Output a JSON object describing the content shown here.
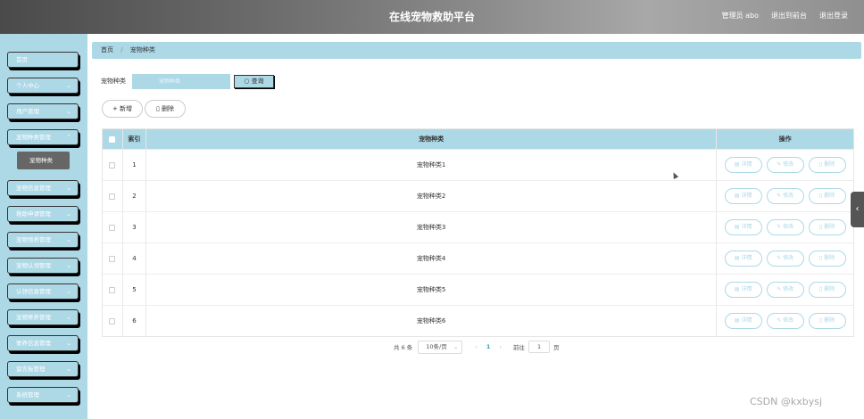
{
  "header": {
    "title": "在线宠物救助平台",
    "admin_label": "管理员 abo",
    "back_to_front": "退出到前台",
    "logout": "退出登录"
  },
  "sidebar": {
    "items": [
      {
        "label": "首页"
      },
      {
        "label": "个人中心"
      },
      {
        "label": "用户管理"
      },
      {
        "label": "宠物种类管理"
      },
      {
        "label": "宠物信息管理"
      },
      {
        "label": "救助申请管理"
      },
      {
        "label": "宠物领养管理"
      },
      {
        "label": "宠物认领管理"
      },
      {
        "label": "认领信息管理"
      },
      {
        "label": "宠物寄养管理"
      },
      {
        "label": "寄养信息管理"
      },
      {
        "label": "留言板管理"
      },
      {
        "label": "系统管理"
      }
    ],
    "submenu_item": "宠物种类"
  },
  "breadcrumb": {
    "home": "首页",
    "current": "宠物种类"
  },
  "search": {
    "label": "宠物种类",
    "placeholder": "宠物种类",
    "button": "查询"
  },
  "actions": {
    "add": "新增",
    "delete": "删除"
  },
  "table": {
    "headers": {
      "index": "索引",
      "name": "宠物种类",
      "ops": "操作"
    },
    "rows": [
      {
        "index": "1",
        "name": "宠物种类1"
      },
      {
        "index": "2",
        "name": "宠物种类2"
      },
      {
        "index": "3",
        "name": "宠物种类3"
      },
      {
        "index": "4",
        "name": "宠物种类4"
      },
      {
        "index": "5",
        "name": "宠物种类5"
      },
      {
        "index": "6",
        "name": "宠物种类6"
      }
    ],
    "op_labels": {
      "detail": "详情",
      "edit": "修改",
      "delete": "删除"
    }
  },
  "pagination": {
    "total": "共 6 条",
    "page_size": "10条/页",
    "current_page": "1",
    "goto_prefix": "前往",
    "goto_value": "1",
    "goto_suffix": "页"
  },
  "watermark": "CSDN @kxbysj",
  "colors": {
    "accent": "#add8e6",
    "topbar": "#6b6b6b",
    "submenu": "#666666",
    "page_active": "#2ea0d0"
  }
}
